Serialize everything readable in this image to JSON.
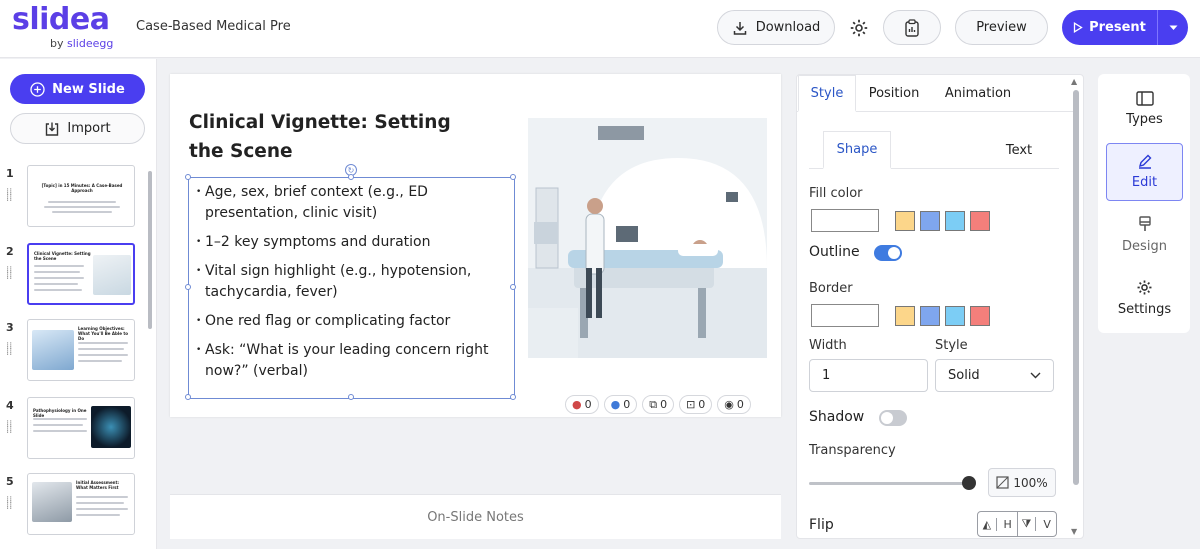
{
  "app": {
    "logo": "slidea",
    "logo_sub_prefix": "by",
    "logo_sub_brand": "slideegg",
    "doc_title": "Case-Based Medical Presentation"
  },
  "toolbar": {
    "download_label": "Download",
    "preview_label": "Preview",
    "present_label": "Present"
  },
  "left": {
    "new_slide_label": "New Slide",
    "import_label": "Import",
    "thumbnails": [
      {
        "num": "1",
        "title": "[Topic] in 15 Minutes: A Case-Based Approach"
      },
      {
        "num": "2",
        "title": "Clinical Vignette: Setting the Scene"
      },
      {
        "num": "3",
        "title": "Learning Objectives: What You'll Be Able to Do"
      },
      {
        "num": "4",
        "title": "Pathophysiology in One Slide"
      },
      {
        "num": "5",
        "title": "Initial Assessment: What Matters First"
      }
    ]
  },
  "slide": {
    "title": "Clinical Vignette: Setting the Scene",
    "bullets": [
      "Age, sex, brief context (e.g., ED presentation, clinic visit)",
      "1–2 key symptoms and duration",
      "Vital sign highlight (e.g., hypotension, tachycardia, fever)",
      "One red flag or complicating factor",
      "Ask: “What is your leading concern right now?” (verbal)"
    ],
    "reactions": [
      "0",
      "0",
      "0",
      "0",
      "0"
    ]
  },
  "notes_label": "On-Slide Notes",
  "props": {
    "tabs": [
      "Style",
      "Position",
      "Animation"
    ],
    "subtabs": [
      "Shape",
      "Text"
    ],
    "fill_color_label": "Fill color",
    "outline_label": "Outline",
    "border_label": "Border",
    "width_label": "Width",
    "width_value": "1",
    "style_label": "Style",
    "style_value": "Solid",
    "shadow_label": "Shadow",
    "transparency_label": "Transparency",
    "transparency_value": "100%",
    "transparency_level": 1.0,
    "flip_label": "Flip",
    "flip_h": "H",
    "flip_v": "V",
    "swatches": [
      "#fcd68a",
      "#7fa6ef",
      "#7ccdf5",
      "#f47f7b"
    ],
    "outline_on": true,
    "shadow_on": false
  },
  "rail": {
    "items": [
      "Types",
      "Edit",
      "Design",
      "Settings"
    ]
  },
  "colors": {
    "accent": "#4a3ef0",
    "link_blue": "#2b56c6"
  }
}
